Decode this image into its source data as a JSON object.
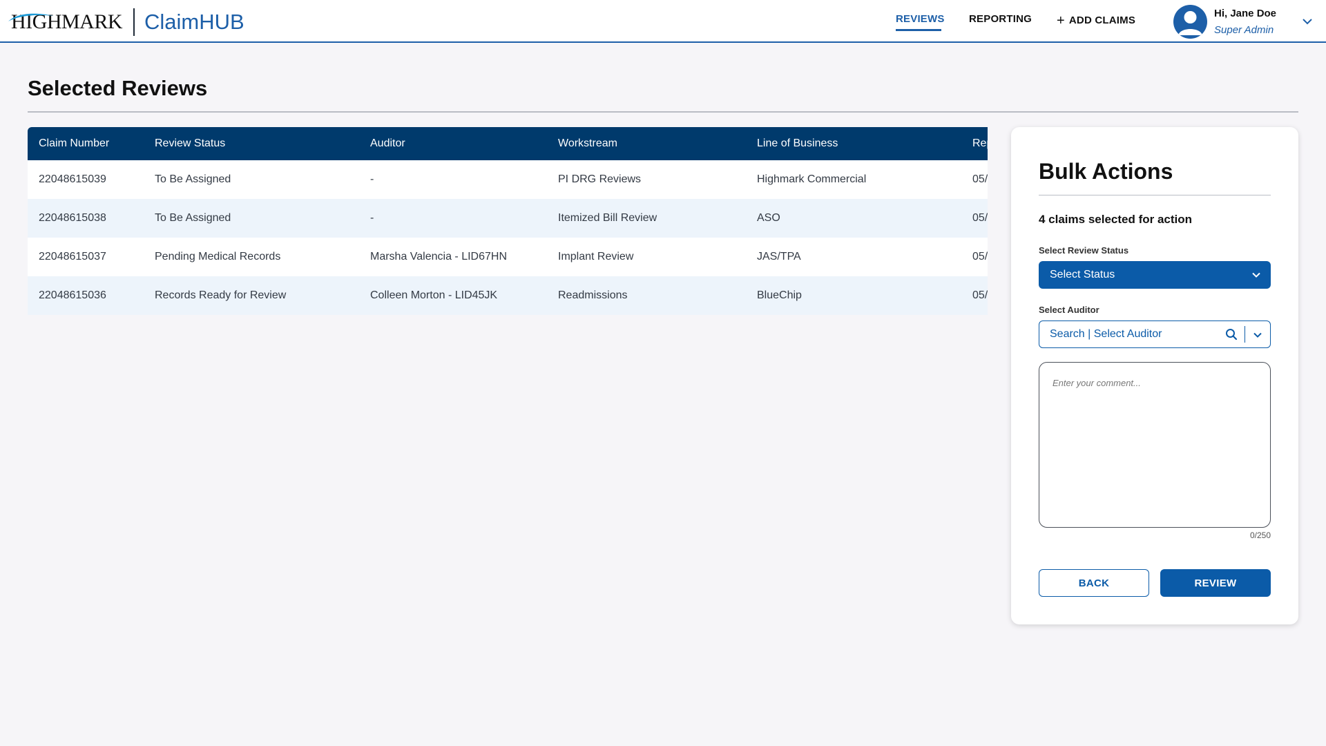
{
  "brand": {
    "company": "HIGHMARK",
    "product": "ClaimHUB",
    "colors": {
      "primary": "#1d5fa8",
      "header_table": "#003a6c",
      "button": "#0b5ba8"
    }
  },
  "nav": {
    "reviews": "REVIEWS",
    "reporting": "REPORTING",
    "add_claims": "ADD CLAIMS",
    "active": "REVIEWS"
  },
  "user": {
    "greeting": "Hi, Jane Doe",
    "role": "Super Admin",
    "icons": {
      "avatar": "user-avatar-icon",
      "menu": "chevron-down-icon"
    }
  },
  "page": {
    "title": "Selected Reviews"
  },
  "table": {
    "columns": [
      "Claim Number",
      "Review Status",
      "Auditor",
      "Workstream",
      "Line of Business",
      "Rep"
    ],
    "rows": [
      [
        "22048615039",
        "To Be Assigned",
        "-",
        "PI DRG Reviews",
        "Highmark Commercial",
        "05/"
      ],
      [
        "22048615038",
        "To Be Assigned",
        "-",
        "Itemized Bill Review",
        "ASO",
        "05/"
      ],
      [
        "22048615037",
        "Pending Medical Records",
        "Marsha Valencia - LID67HN",
        "Implant Review",
        "JAS/TPA",
        "05/"
      ],
      [
        "22048615036",
        "Records Ready for Review",
        "Colleen Morton - LID45JK",
        "Readmissions",
        "BlueChip",
        "05/"
      ]
    ]
  },
  "bulk": {
    "title": "Bulk Actions",
    "count_text": "4 claims selected for action",
    "status_label": "Select Review Status",
    "status_value": "Select Status",
    "auditor_label": "Select Auditor",
    "auditor_placeholder": "Search | Select Auditor",
    "comment_placeholder": "Enter your comment...",
    "char_count": "0/250",
    "back_label": "BACK",
    "review_label": "REVIEW"
  }
}
